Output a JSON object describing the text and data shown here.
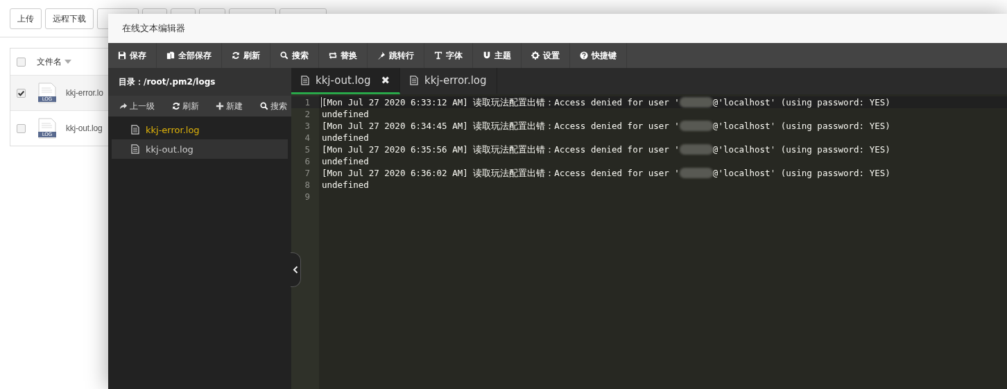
{
  "background": {
    "toolbar_buttons": [
      {
        "label": "上传"
      },
      {
        "label": "远程下载"
      }
    ],
    "table": {
      "header": {
        "checked": false,
        "label": "文件名"
      },
      "rows": [
        {
          "checked": true,
          "badge": "LOG",
          "name": "kkj-error.lo"
        },
        {
          "checked": false,
          "badge": "LOG",
          "name": "kkj-out.log"
        }
      ]
    }
  },
  "editor": {
    "title": "在线文本编辑器",
    "toolbar": [
      {
        "label": "保存"
      },
      {
        "label": "全部保存"
      },
      {
        "label": "刷新"
      },
      {
        "label": "搜索"
      },
      {
        "label": "替换"
      },
      {
        "label": "跳转行"
      },
      {
        "label": "字体"
      },
      {
        "label": "主题"
      },
      {
        "label": "设置"
      },
      {
        "label": "快捷键"
      }
    ],
    "sidebar": {
      "directory_label": "目录：",
      "path": "/root/.pm2/logs",
      "actions": [
        {
          "label": "上一级"
        },
        {
          "label": "刷新"
        },
        {
          "label": "新建"
        },
        {
          "label": "搜索"
        }
      ],
      "files": [
        {
          "name": "kkj-error.log",
          "highlighted": true,
          "selected": false
        },
        {
          "name": "kkj-out.log",
          "highlighted": false,
          "selected": true
        }
      ]
    },
    "tabs": [
      {
        "label": "kkj-out.log",
        "selected": true,
        "closable": true,
        "close_glyph": "✖"
      },
      {
        "label": "kkj-error.log",
        "selected": false,
        "closable": false
      }
    ],
    "lines": [
      {
        "number": "1",
        "active": true,
        "before": "[Mon Jul 27 2020 6:33:12 AM] 读取玩法配置出错：Access denied for user '",
        "redacted": true,
        "after": "@'localhost' (using password: YES)"
      },
      {
        "number": "2",
        "active": false,
        "before": "undefined",
        "redacted": false
      },
      {
        "number": "3",
        "active": false,
        "before": "[Mon Jul 27 2020 6:34:45 AM] 读取玩法配置出错：Access denied for user '",
        "redacted": true,
        "after": "@'localhost' (using password: YES)"
      },
      {
        "number": "4",
        "active": false,
        "before": "undefined",
        "redacted": false
      },
      {
        "number": "5",
        "active": false,
        "before": "[Mon Jul 27 2020 6:35:56 AM] 读取玩法配置出错：Access denied for user '",
        "redacted": true,
        "after": "@'localhost' (using password: YES)"
      },
      {
        "number": "6",
        "active": false,
        "before": "undefined",
        "redacted": false
      },
      {
        "number": "7",
        "active": false,
        "before": "[Mon Jul 27 2020 6:36:02 AM] 读取玩法配置出错：Access denied for user '",
        "redacted": true,
        "after": "@'localhost' (using password: YES)"
      },
      {
        "number": "8",
        "active": false,
        "before": "undefined",
        "redacted": false
      },
      {
        "number": "9",
        "active": false
      }
    ]
  }
}
